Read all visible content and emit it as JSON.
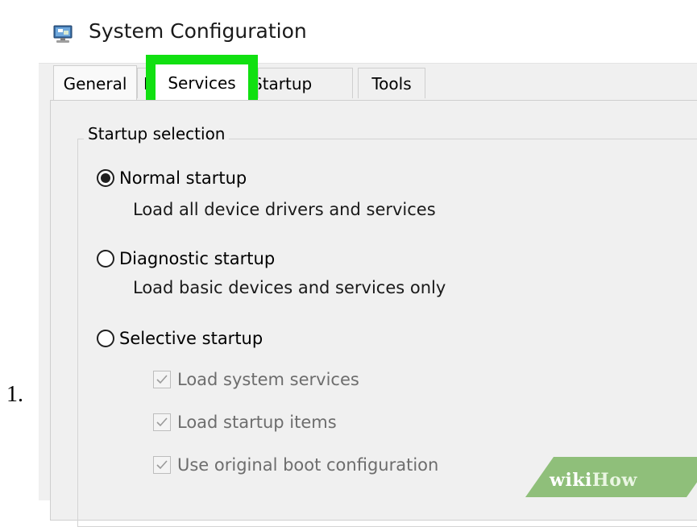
{
  "step": {
    "number": "1."
  },
  "window": {
    "title": "System Configuration",
    "icon": "system-config-icon"
  },
  "tabs": [
    {
      "label": "General"
    },
    {
      "label": "Boot"
    },
    {
      "label": "Services"
    },
    {
      "label": "Startup"
    },
    {
      "label": "Tools"
    }
  ],
  "highlight": {
    "target_tab": "Services",
    "color": "#11e011"
  },
  "startup_selection": {
    "label": "Startup selection",
    "options": [
      {
        "label": "Normal startup",
        "description": "Load all device drivers and services",
        "selected": true
      },
      {
        "label": "Diagnostic startup",
        "description": "Load basic devices and services only",
        "selected": false
      },
      {
        "label": "Selective startup",
        "selected": false
      }
    ],
    "selective_items": [
      {
        "label": "Load system services",
        "checked": true,
        "disabled": true
      },
      {
        "label": "Load startup items",
        "checked": true,
        "disabled": true
      },
      {
        "label": "Use original boot configuration",
        "checked": true,
        "disabled": true
      }
    ]
  },
  "watermark": {
    "part1": "wiki",
    "part2": "How",
    "color": "#8fbf7a"
  }
}
